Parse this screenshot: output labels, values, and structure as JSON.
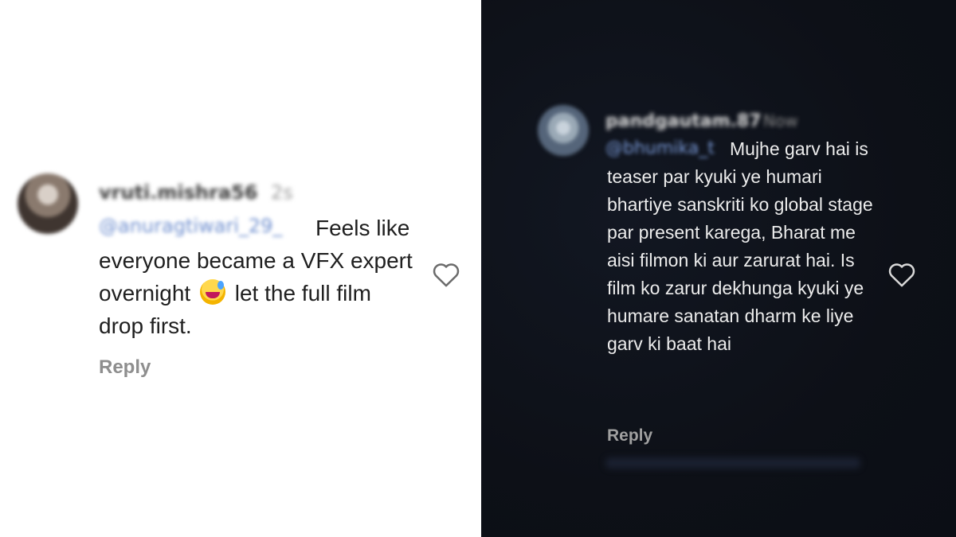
{
  "left_comment": {
    "username": "vruti.mishra56",
    "time": "2s",
    "mention": "@anuragtiwari_29_",
    "text": "Feels like everyone became a VFX expert overnight",
    "text_after_emoji": "let the full film drop first.",
    "emoji": "grinning-sweat-face",
    "reply_label": "Reply",
    "icons": {
      "like": "heart-outline-icon"
    }
  },
  "right_comment": {
    "username": "pandgautam.87",
    "time": "Now",
    "mention": "@bhumika_t",
    "text": "Mujhe garv hai is teaser par kyuki ye humari bhartiye sanskriti ko global stage par present karega, Bharat me aisi filmon ki aur zarurat hai. Is film ko zarur dekhunga kyuki ye humare sanatan dharm ke liye garv ki baat hai",
    "reply_label": "Reply",
    "icons": {
      "like": "heart-outline-icon"
    }
  },
  "colors": {
    "left_background": "#ffffff",
    "right_background": "#0e1118",
    "mention": "#6f8fcf"
  }
}
